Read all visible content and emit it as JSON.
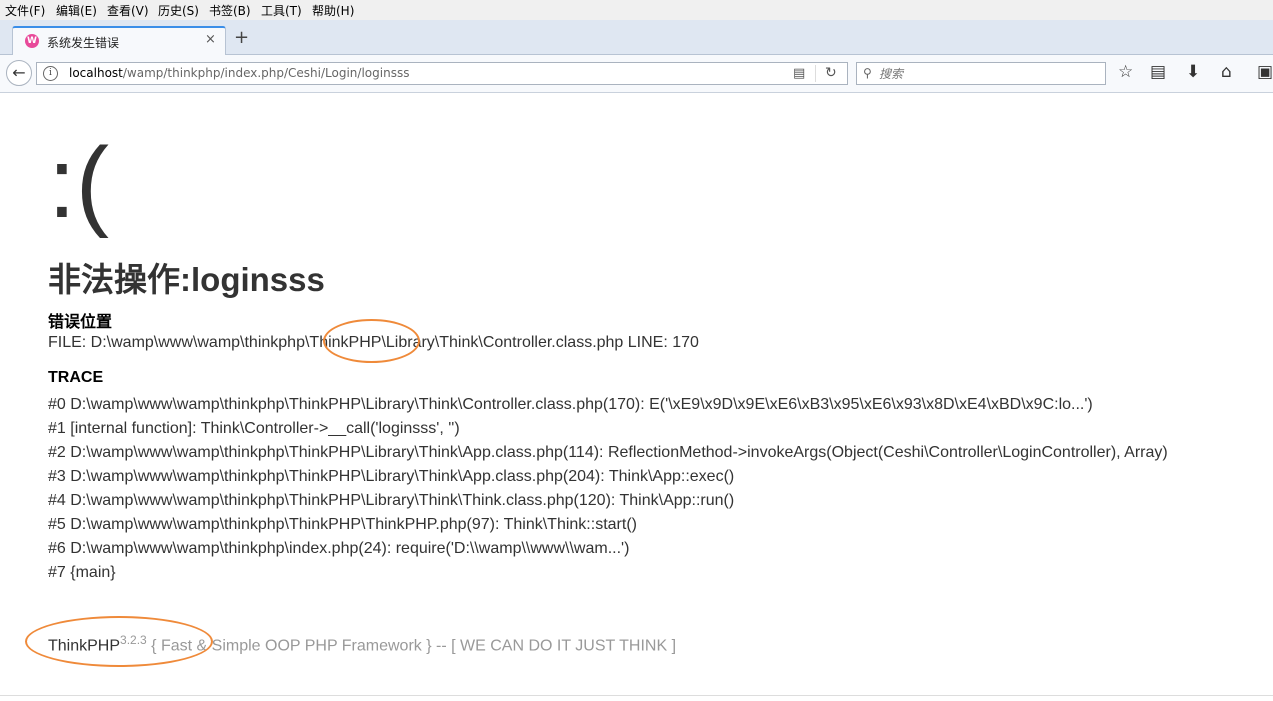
{
  "menu": [
    "文件(F)",
    "编辑(E)",
    "查看(V)",
    "历史(S)",
    "书签(B)",
    "工具(T)",
    "帮助(H)"
  ],
  "tab": {
    "title": "系统发生错误",
    "favicon": "W",
    "close": "×",
    "new_tab": "+"
  },
  "nav": {
    "url_host": "localhost",
    "url_path": "/wamp/thinkphp/index.php/Ceshi/Login/loginsss",
    "search_placeholder": "搜索"
  },
  "page": {
    "face": ":(",
    "title": "非法操作:loginsss",
    "location_heading": "错误位置",
    "file_line": "FILE: D:\\wamp\\www\\wamp\\thinkphp\\ThinkPHP\\Library\\Think\\Controller.class.php     LINE: 170",
    "trace_heading": "TRACE",
    "trace": [
      "#0 D:\\wamp\\www\\wamp\\thinkphp\\ThinkPHP\\Library\\Think\\Controller.class.php(170): E('\\xE9\\x9D\\x9E\\xE6\\xB3\\x95\\xE6\\x93\\x8D\\xE4\\xBD\\x9C:lo...')",
      "#1 [internal function]: Think\\Controller->__call('loginsss', '')",
      "#2 D:\\wamp\\www\\wamp\\thinkphp\\ThinkPHP\\Library\\Think\\App.class.php(114): ReflectionMethod->invokeArgs(Object(Ceshi\\Controller\\LoginController), Array)",
      "#3 D:\\wamp\\www\\wamp\\thinkphp\\ThinkPHP\\Library\\Think\\App.class.php(204): Think\\App::exec()",
      "#4 D:\\wamp\\www\\wamp\\thinkphp\\ThinkPHP\\Library\\Think\\Think.class.php(120): Think\\App::run()",
      "#5 D:\\wamp\\www\\wamp\\thinkphp\\ThinkPHP\\ThinkPHP.php(97): Think\\Think::start()",
      "#6 D:\\wamp\\www\\wamp\\thinkphp\\index.php(24): require('D:\\\\wamp\\\\www\\\\wam...')",
      "#7 {main}"
    ],
    "footer_brand": "ThinkPHP",
    "footer_version": "3.2.3",
    "footer_slogan": " { Fast & Simple OOP PHP Framework } -- [ WE CAN DO IT JUST THINK ]"
  },
  "colors": {
    "annotation": "#ef8a3a",
    "accent": "#3b8ee8"
  }
}
